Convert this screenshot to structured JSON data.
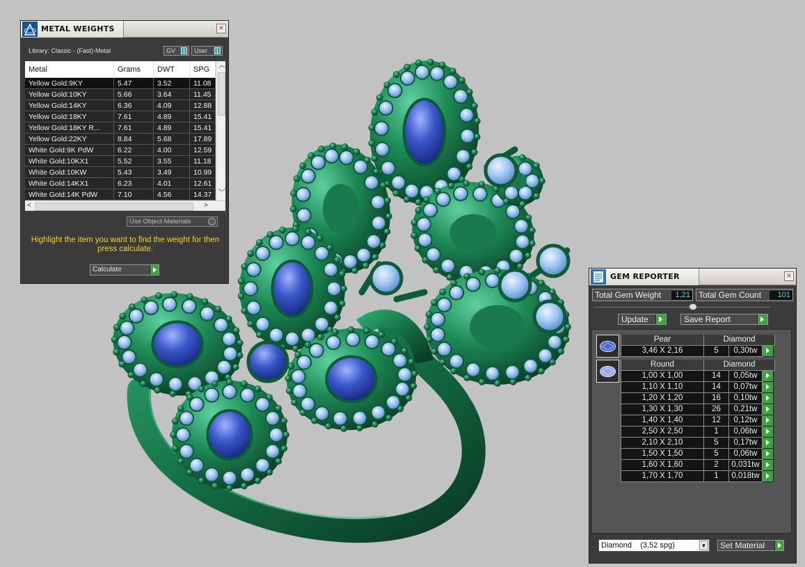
{
  "metal_weights": {
    "title": "METAL WEIGHTS",
    "library_label": "Library: Classic - (Fast)-Metal",
    "toggle_gv": "GV",
    "toggle_user": "User",
    "columns": [
      "Metal",
      "Grams",
      "DWT",
      "SPG"
    ],
    "rows": [
      [
        "Yellow Gold:9KY",
        "5.47",
        "3.52",
        "11.08"
      ],
      [
        "Yellow Gold:10KY",
        "5.66",
        "3.64",
        "11.45"
      ],
      [
        "Yellow Gold:14KY",
        "6.36",
        "4.09",
        "12.88"
      ],
      [
        "Yellow Gold:18KY",
        "7.61",
        "4.89",
        "15.41"
      ],
      [
        "Yellow Gold:18KY R...",
        "7.61",
        "4.89",
        "15.41"
      ],
      [
        "Yellow Gold:22KY",
        "8.84",
        "5.68",
        "17.89"
      ],
      [
        "White Gold:9K PdW",
        "6.22",
        "4.00",
        "12.59"
      ],
      [
        "White Gold:10KX1",
        "5.52",
        "3.55",
        "11.18"
      ],
      [
        "White Gold:10KW",
        "5.43",
        "3.49",
        "10.99"
      ],
      [
        "White Gold:14KX1",
        "6.23",
        "4.01",
        "12.61"
      ],
      [
        "White Gold:14K PdW",
        "7.10",
        "4.56",
        "14.37"
      ]
    ],
    "use_object_materials": "Use Object Materials",
    "hint": "Highlight the item you want to find the weight for then press calculate.",
    "calculate_label": "Calculate"
  },
  "gem_reporter": {
    "title": "GEM REPORTER",
    "total_weight_label": "Total Gem Weight",
    "total_weight_value": "1,21",
    "total_count_label": "Total Gem Count",
    "total_count_value": "101",
    "update_label": "Update",
    "save_report_label": "Save Report",
    "groups": [
      {
        "shape": "Pear",
        "material": "Diamond",
        "rows": [
          [
            "3,46 X 2,16",
            "5",
            "0,30tw"
          ]
        ]
      },
      {
        "shape": "Round",
        "material": "Diamond",
        "rows": [
          [
            "1,00 X 1,00",
            "14",
            "0,05tw"
          ],
          [
            "1,10 X 1,10",
            "14",
            "0,07tw"
          ],
          [
            "1,20 X 1,20",
            "16",
            "0,10tw"
          ],
          [
            "1,30 X 1,30",
            "26",
            "0,21tw"
          ],
          [
            "1,40 X 1,40",
            "12",
            "0,12tw"
          ],
          [
            "2,50 X 2,50",
            "1",
            "0,06tw"
          ],
          [
            "2,10 X 2,10",
            "5",
            "0,17tw"
          ],
          [
            "1,50 X 1,50",
            "5",
            "0,06tw"
          ],
          [
            "1,60 X 1,60",
            "2",
            "0,031tw"
          ],
          [
            "1,70 X 1,70",
            "1",
            "0,018tw"
          ]
        ]
      }
    ],
    "material_select": "Diamond    (3,52 spg)",
    "set_material_label": "Set Material"
  },
  "colors": {
    "background": "#c2c2c2",
    "metal": "#1a7a4c",
    "gem_light": "#8ab8ee",
    "gem_dark": "#2a45b0",
    "panel": "#3b3b3b",
    "accent_green": "#3fa33f",
    "hint_yellow": "#f2d41a"
  }
}
